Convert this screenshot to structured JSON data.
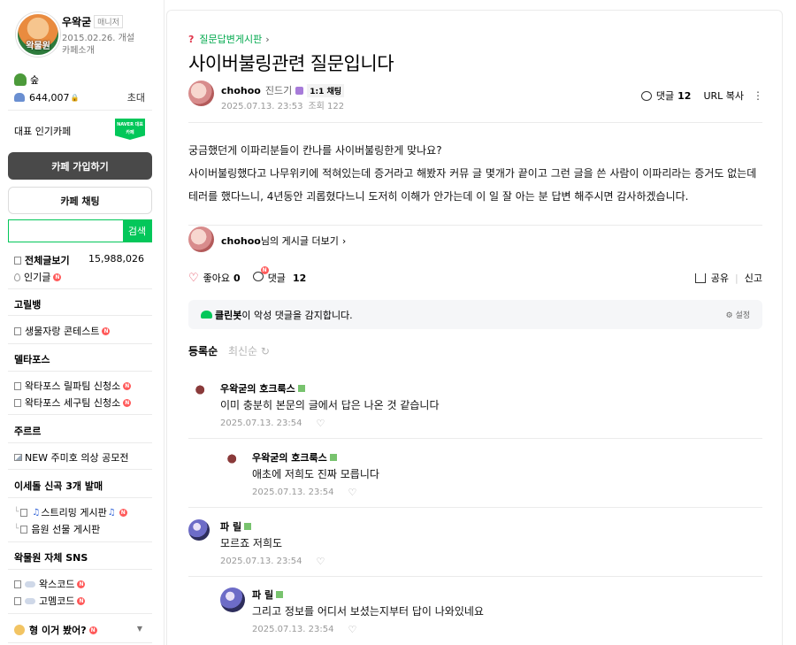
{
  "sidebar": {
    "cafe_name": "우왁굳",
    "manager_badge": "매니저",
    "created": "2015.02.26. 개설",
    "intro": "카페소개",
    "logo_text": "왁물원",
    "level": "숲",
    "members": "644,007",
    "invite": "초대",
    "representative": "대표 인기카페",
    "naver_badge": "NAVER 대표카페",
    "join_label": "카페 가입하기",
    "chat_label": "카페 채팅",
    "search_placeholder": "",
    "search_label": "검색",
    "all_posts": "전체글보기",
    "all_posts_count": "15,988,026",
    "popular": "인기글",
    "groups": [
      {
        "title": "고릴뱅",
        "items": [
          "생물자랑 콘테스트"
        ]
      },
      {
        "title": "델타포스",
        "items": [
          "왁타포스 릴파팀 신청소",
          "왁타포스 세구팀 신청소"
        ]
      },
      {
        "title": "주르르",
        "items": [
          "NEW 주미호 의상 공모전"
        ]
      },
      {
        "title": "이세돌 신곡 3개 발매",
        "items": [
          "스트리밍 게시판",
          "음원 선물 게시판"
        ]
      },
      {
        "title": "왁물원 자체 SNS",
        "items": [
          "왁스코드",
          "고멤코드"
        ]
      }
    ],
    "bottom_group": "형 이거 봤어?",
    "new_mark": "N"
  },
  "post": {
    "board": "질문답변게시판",
    "title": "사이버불링관련 질문입니다",
    "author": "chohoo",
    "grade": "진드기",
    "chat_tag": "1:1 채팅",
    "date": "2025.07.13. 23:53",
    "views": "조회 122",
    "comment_label": "댓글",
    "comment_count": "12",
    "url_copy": "URL 복사",
    "body": [
      "궁금했던게 이파리분들이 칸나를 사이버불링한게 맞나요?",
      "사이버불링했다고 나무위키에 적혀있는데 증거라고 해봤자 커뮤 글 몇개가 끝이고 그런 글을 쓴 사람이 이파리라는 증거도 없는데",
      "테러를 했다느니, 4년동안 괴롭혔다느니 도저히 이해가 안가는데 이 일 잘 아는 분 답변 해주시면 감사하겠습니다."
    ],
    "more_posts_nick": "chohoo",
    "more_posts_suffix": "님의 게시글 더보기",
    "like_label": "좋아요",
    "like_count": "0",
    "share": "공유",
    "report": "신고",
    "cleanbot_name": "클린봇",
    "cleanbot_text": "이 악성 댓글을 감지합니다.",
    "settings": "설정",
    "sort_active": "등록순",
    "sort_inactive": "최신순"
  },
  "comments": [
    {
      "nick": "우왁굳의 호크룩스",
      "text": "이미 충분히 본문의 글에서 답은 나온 것 같습니다",
      "date": "2025.07.13. 23:54"
    },
    {
      "nick": "우왁굳의 호크룩스",
      "text": "애초에 저희도 진짜 모릅니다",
      "date": "2025.07.13. 23:54"
    },
    {
      "nick": "파 릴",
      "text": "모르죠 저희도",
      "date": "2025.07.13. 23:54"
    },
    {
      "nick": "파 릴",
      "text": "그리고 정보를 어디서 보셨는지부터 답이 나와있네요",
      "date": "2025.07.13. 23:54"
    }
  ]
}
